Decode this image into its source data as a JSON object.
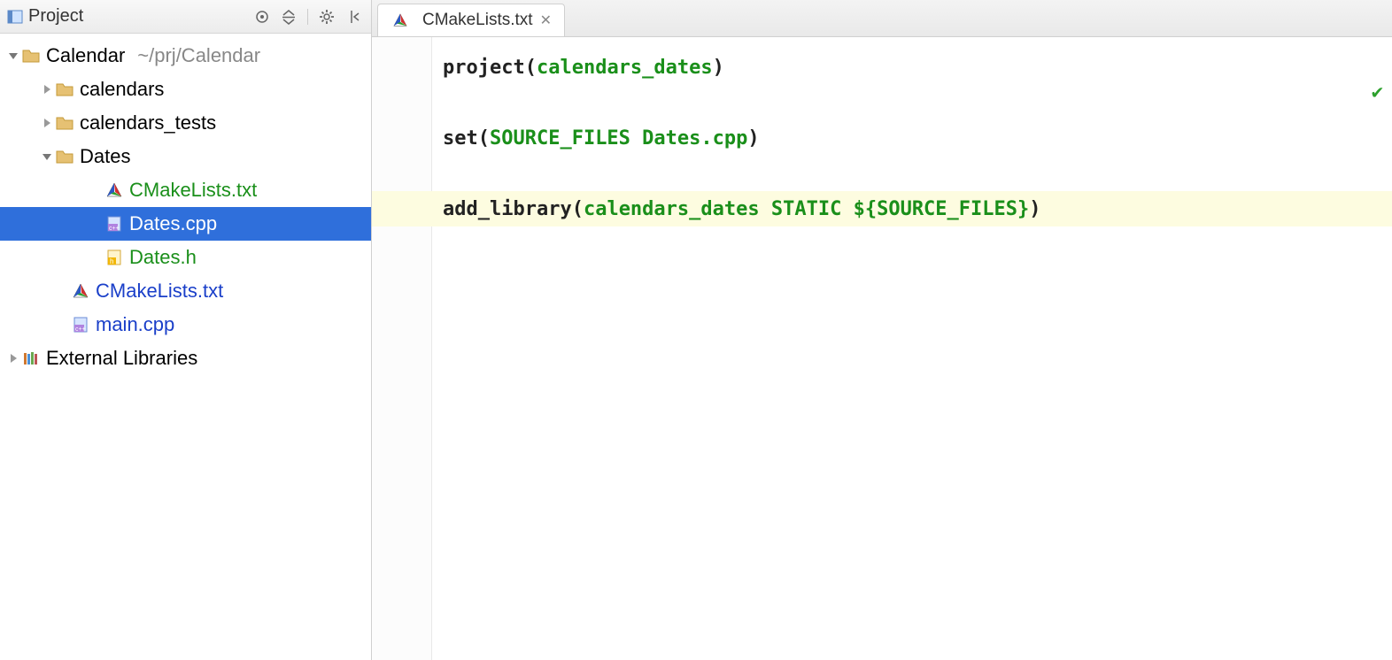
{
  "sidebar": {
    "title": "Project",
    "root": {
      "name": "Calendar",
      "path": "~/prj/Calendar"
    },
    "folders": {
      "calendars": "calendars",
      "calendars_tests": "calendars_tests",
      "dates": "Dates"
    },
    "files": {
      "dates_cmake": "CMakeLists.txt",
      "dates_cpp": "Dates.cpp",
      "dates_h": "Dates.h",
      "root_cmake": "CMakeLists.txt",
      "main_cpp": "main.cpp"
    },
    "external": "External Libraries"
  },
  "tab": {
    "label": "CMakeLists.txt"
  },
  "code": {
    "l1_a": "project(",
    "l1_b": "calendars_dates",
    "l1_c": ")",
    "l2_a": "set(",
    "l2_b": "SOURCE_FILES Dates.cpp",
    "l2_c": ")",
    "l3_a": "add_library(",
    "l3_b": "calendars_dates STATIC ${SOURCE_FILES}",
    "l3_c": ")"
  }
}
